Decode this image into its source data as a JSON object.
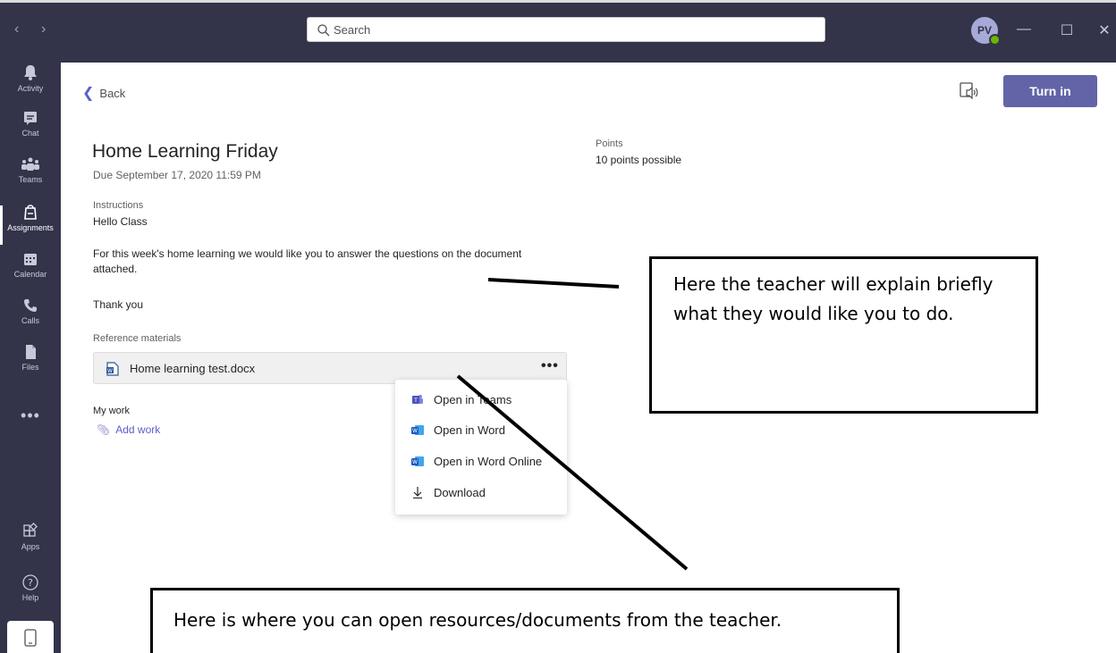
{
  "search": {
    "placeholder": "Search"
  },
  "avatar": {
    "initials": "PV"
  },
  "rail": [
    {
      "label": "Activity",
      "icon": "bell-icon"
    },
    {
      "label": "Chat",
      "icon": "chat-icon"
    },
    {
      "label": "Teams",
      "icon": "teams-icon"
    },
    {
      "label": "Assignments",
      "icon": "assignments-icon",
      "active": true
    },
    {
      "label": "Calendar",
      "icon": "calendar-icon"
    },
    {
      "label": "Calls",
      "icon": "phone-icon"
    },
    {
      "label": "Files",
      "icon": "file-icon"
    }
  ],
  "rail_bottom": [
    {
      "label": "Apps",
      "icon": "apps-icon"
    },
    {
      "label": "Help",
      "icon": "help-icon"
    }
  ],
  "header": {
    "back_label": "Back",
    "turn_in_label": "Turn in"
  },
  "assignment": {
    "title": "Home Learning Friday",
    "due": "Due September 17, 2020 11:59 PM",
    "points_label": "Points",
    "points_value": "10 points possible",
    "instructions_label": "Instructions",
    "instructions": [
      "Hello Class",
      "For this week's home learning we would like you to answer the questions on the document attached.",
      "Thank you"
    ],
    "reference_label": "Reference materials",
    "attachment_name": "Home learning test.docx",
    "my_work_label": "My work",
    "add_work_label": "Add work"
  },
  "menu": [
    {
      "label": "Open in Teams",
      "icon": "teams-icon"
    },
    {
      "label": "Open in Word",
      "icon": "word-icon"
    },
    {
      "label": "Open in Word Online",
      "icon": "word-icon"
    },
    {
      "label": "Download",
      "icon": "download-icon"
    }
  ],
  "annotations": {
    "callout1": "Here the teacher will explain briefly what they would like you to do.",
    "callout2": "Here is where you can open resources/documents from the teacher."
  },
  "colors": {
    "rail": "#33344a",
    "accent": "#6264a7",
    "link": "#5b5fc7"
  }
}
